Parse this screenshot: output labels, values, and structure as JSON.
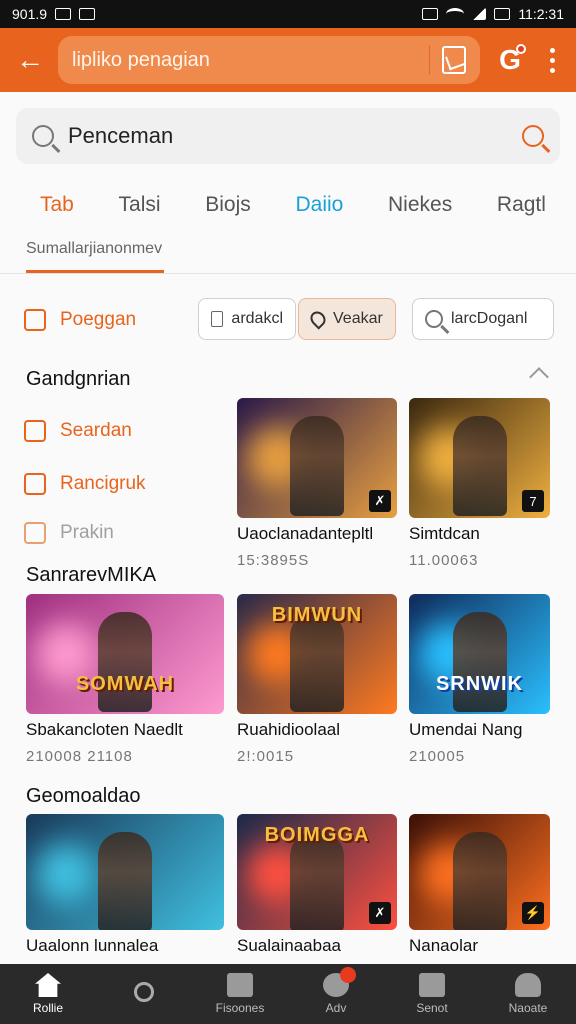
{
  "status_bar": {
    "left_text": "901.9",
    "time": "11:2:31"
  },
  "app_bar": {
    "search_text": "lipliko penagian"
  },
  "search": {
    "value": "Penceman"
  },
  "tabs": [
    {
      "label": "Tab"
    },
    {
      "label": "Talsi"
    },
    {
      "label": "Biojs"
    },
    {
      "label": "Daiio"
    },
    {
      "label": "Niekes"
    },
    {
      "label": "Ragtl"
    }
  ],
  "subline": "Sumallarjianonmev",
  "sidebar": {
    "item_top": "Poeggan",
    "section": "Gandgnrian",
    "items": [
      {
        "label": "Seardan"
      },
      {
        "label": "Rancigruk"
      },
      {
        "label": "Prakin"
      }
    ]
  },
  "chips": [
    {
      "label": "ardakcl"
    },
    {
      "label": "Veakar"
    },
    {
      "label": "larcDoganl"
    }
  ],
  "sections": {
    "s2": "SanrarevMIKA",
    "s3": "Geomoaldao"
  },
  "cards": [
    {
      "title": "Uaoclanadantepltl",
      "sub": "15:3895S",
      "badge": "✗",
      "logo": "",
      "colors": [
        "#2a1a4a",
        "#e8a040"
      ]
    },
    {
      "title": "Simtdcan",
      "sub": "11.00063",
      "badge": "7",
      "logo": "",
      "colors": [
        "#3a2810",
        "#f0b040"
      ]
    },
    {
      "title": "Sbakancloten Naedlt",
      "sub": "210008 21108",
      "badge": "",
      "logo": "SOMWAH",
      "colors": [
        "#a03080",
        "#ff9ad0"
      ]
    },
    {
      "title": "Ruahidioolaal",
      "sub": "2!:0015",
      "badge": "",
      "logo": "BIMWUN",
      "colors": [
        "#2a2a4a",
        "#ff7a20"
      ]
    },
    {
      "title": "Umendai Nang",
      "sub": "210005",
      "badge": "",
      "logo": "SRNWIK",
      "colors": [
        "#102a5a",
        "#2ac0ff"
      ]
    },
    {
      "title": "Uaalonn lunnalea",
      "sub": "",
      "badge": "",
      "logo": "",
      "colors": [
        "#1a3a5a",
        "#40c0e0"
      ]
    },
    {
      "title": "Sualainaabaa",
      "sub": "",
      "badge": "✗",
      "logo": "BOIMGGA",
      "colors": [
        "#1a2a4a",
        "#ff5040"
      ]
    },
    {
      "title": "Nanaolar",
      "sub": "",
      "badge": "⚡",
      "logo": "",
      "colors": [
        "#3a1008",
        "#ff7020"
      ]
    }
  ],
  "bottom_nav": [
    {
      "label": "Rollie"
    },
    {
      "label": ""
    },
    {
      "label": "Fisoones"
    },
    {
      "label": "Adv"
    },
    {
      "label": "Senot"
    },
    {
      "label": "Naoate"
    }
  ]
}
